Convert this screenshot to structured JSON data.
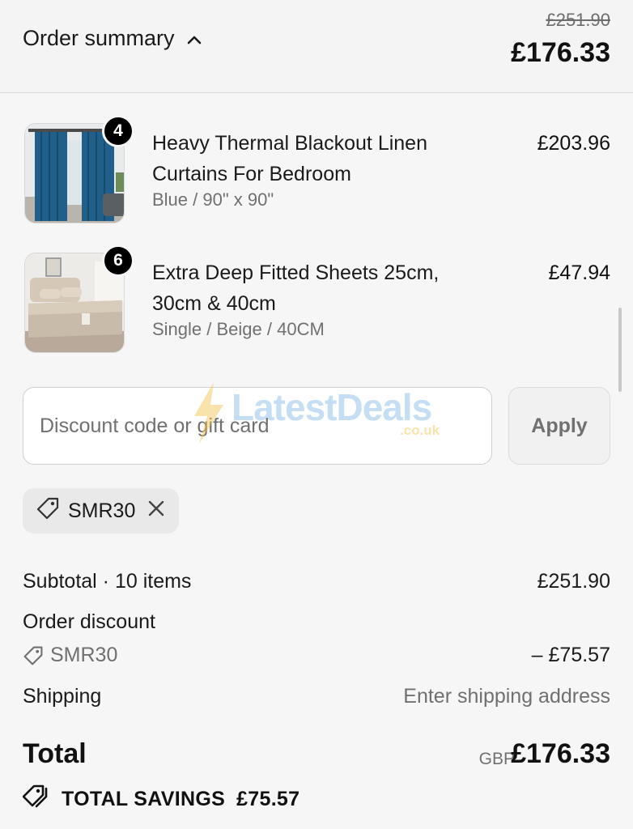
{
  "header": {
    "toggle_label": "Order summary",
    "compare_price": "£251.90",
    "total_price": "£176.33"
  },
  "items": [
    {
      "title": "Heavy Thermal Blackout Linen Curtains For Bedroom",
      "variant": "Blue / 90\" x 90\"",
      "price": "£203.96",
      "quantity": "4"
    },
    {
      "title": "Extra Deep Fitted Sheets 25cm, 30cm & 40cm",
      "variant": "Single / Beige / 40CM",
      "price": "£47.94",
      "quantity": "6"
    }
  ],
  "discount": {
    "placeholder": "Discount code or gift card",
    "apply_label": "Apply",
    "applied_code": "SMR30"
  },
  "watermark": {
    "text": "LatestDeals",
    "sub": ".co.uk"
  },
  "summary": {
    "subtotal_label": "Subtotal · 10 items",
    "subtotal_value": "£251.90",
    "discount_label": "Order discount",
    "discount_code": "SMR30",
    "discount_value": "– £75.57",
    "shipping_label": "Shipping",
    "shipping_value": "Enter shipping address",
    "total_label": "Total",
    "total_currency": "GBP",
    "total_value": "£176.33",
    "savings_label": "TOTAL SAVINGS",
    "savings_value": "£75.57"
  },
  "colors": {
    "accent": "#000000",
    "muted": "#707070",
    "background": "#f6f6f6"
  }
}
